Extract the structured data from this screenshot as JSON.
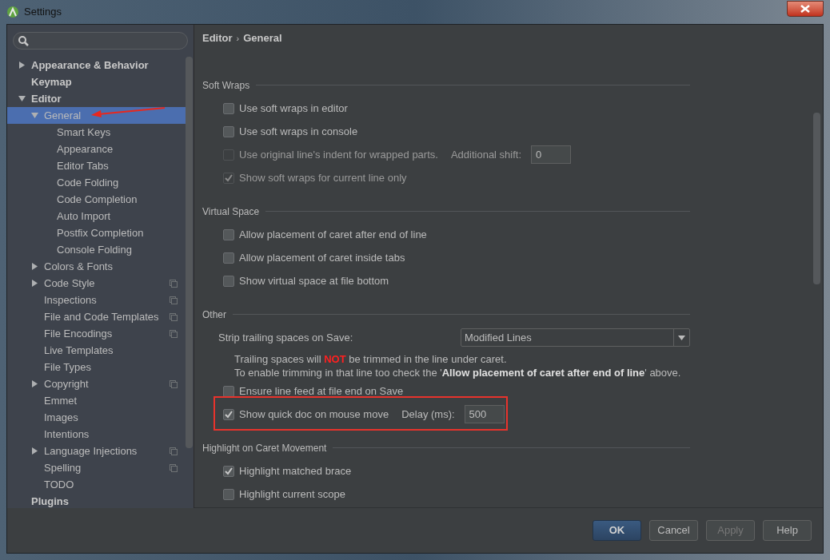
{
  "window": {
    "title": "Settings"
  },
  "tree": [
    {
      "label": "Appearance & Behavior",
      "expanded": false,
      "bold": true,
      "selected": false
    },
    {
      "label": "Keymap",
      "bold": true,
      "selected": false
    },
    {
      "label": "Editor",
      "expanded": true,
      "bold": true,
      "selected": false,
      "children": [
        {
          "label": "General",
          "expanded": true,
          "selected": true,
          "annotated": true,
          "children": [
            {
              "label": "Smart Keys",
              "selected": false
            },
            {
              "label": "Appearance",
              "selected": false
            },
            {
              "label": "Editor Tabs",
              "selected": false
            },
            {
              "label": "Code Folding",
              "selected": false
            },
            {
              "label": "Code Completion",
              "selected": false
            },
            {
              "label": "Auto Import",
              "selected": false
            },
            {
              "label": "Postfix Completion",
              "selected": false
            },
            {
              "label": "Console Folding",
              "selected": false
            }
          ]
        },
        {
          "label": "Colors & Fonts",
          "expanded": false,
          "selected": false
        },
        {
          "label": "Code Style",
          "expanded": false,
          "project": true,
          "selected": false
        },
        {
          "label": "Inspections",
          "project": true,
          "selected": false
        },
        {
          "label": "File and Code Templates",
          "project": true,
          "selected": false
        },
        {
          "label": "File Encodings",
          "project": true,
          "selected": false
        },
        {
          "label": "Live Templates",
          "selected": false
        },
        {
          "label": "File Types",
          "selected": false
        },
        {
          "label": "Copyright",
          "expanded": false,
          "project": true,
          "selected": false
        },
        {
          "label": "Emmet",
          "selected": false
        },
        {
          "label": "Images",
          "selected": false
        },
        {
          "label": "Intentions",
          "selected": false
        },
        {
          "label": "Language Injections",
          "expanded": false,
          "project": true,
          "selected": false
        },
        {
          "label": "Spelling",
          "project": true,
          "selected": false
        },
        {
          "label": "TODO",
          "selected": false
        }
      ]
    },
    {
      "label": "Plugins",
      "bold": true,
      "selected": false
    }
  ],
  "breadcrumb": [
    "Editor",
    "›",
    "General"
  ],
  "rows": [
    {
      "kind": "heading",
      "label": "Soft Wraps"
    },
    {
      "kind": "checkbox",
      "label": "Use soft wraps in editor",
      "checked": false,
      "disabled": false
    },
    {
      "kind": "checkbox",
      "label": "Use soft wraps in console",
      "checked": false,
      "disabled": false
    },
    {
      "kind": "checkbox-field",
      "label": "Use original line's indent for wrapped parts.",
      "checked": false,
      "disabled": true,
      "field_label": "Additional shift:",
      "value": "0"
    },
    {
      "kind": "checkbox",
      "label": "Show soft wraps for current line only",
      "checked": true,
      "disabled": true
    },
    {
      "kind": "heading",
      "label": "Virtual Space"
    },
    {
      "kind": "checkbox",
      "label": "Allow placement of caret after end of line",
      "checked": false,
      "disabled": false
    },
    {
      "kind": "checkbox",
      "label": "Allow placement of caret inside tabs",
      "checked": false,
      "disabled": false
    },
    {
      "kind": "checkbox",
      "label": "Show virtual space at file bottom",
      "checked": false,
      "disabled": false
    },
    {
      "kind": "heading",
      "label": "Other"
    },
    {
      "kind": "combo",
      "label": "Strip trailing spaces on Save:",
      "value": "Modified Lines"
    },
    {
      "kind": "warning-note",
      "text": "Trailing spaces will **NOT** be trimmed in the line under caret."
    },
    {
      "kind": "note",
      "text": "To enable trimming in that line too check the '**Allow placement of caret after end of line**' above."
    },
    {
      "kind": "checkbox",
      "label": "Ensure line feed at file end on Save",
      "checked": false,
      "disabled": false
    },
    {
      "kind": "checkbox-field",
      "label": "Show quick doc on mouse move",
      "checked": true,
      "disabled": false,
      "field_label": "Delay (ms):",
      "value": "500",
      "annotated": true
    },
    {
      "kind": "heading",
      "label": "Highlight on Caret Movement"
    },
    {
      "kind": "checkbox",
      "label": "Highlight matched brace",
      "checked": true,
      "disabled": false
    },
    {
      "kind": "checkbox",
      "label": "Highlight current scope",
      "checked": false,
      "disabled": false
    }
  ],
  "buttons": [
    {
      "label": "OK",
      "kind": "default",
      "disabled": false
    },
    {
      "label": "Cancel",
      "kind": "normal",
      "disabled": false
    },
    {
      "label": "Apply",
      "kind": "normal",
      "disabled": true
    },
    {
      "label": "Help",
      "kind": "normal",
      "disabled": false
    }
  ]
}
